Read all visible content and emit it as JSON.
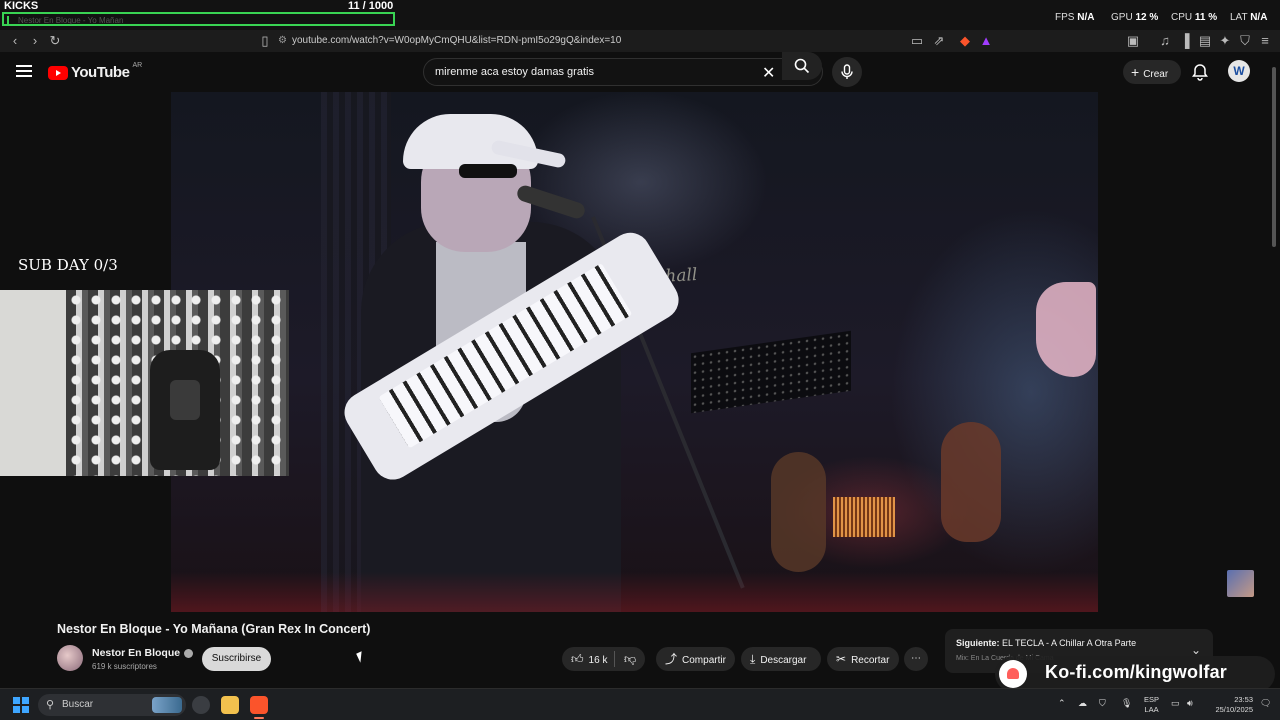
{
  "overlay": {
    "kicks_label": "KICKS",
    "kicks_count": "11  / 1000",
    "tab_ghost": "Nestor En Bloque - Yo Mañan"
  },
  "perf": {
    "fps_label": "FPS",
    "fps_value": "N/A",
    "gpu_label": "GPU",
    "gpu_value": "12 %",
    "cpu_label": "CPU",
    "cpu_value": "11 %",
    "lat_label": "LAT",
    "lat_value": "N/A"
  },
  "browser": {
    "url": "youtube.com/watch?v=W0opMyCmQHU&list=RDN-pmI5o29gQ&index=10"
  },
  "youtube": {
    "logo_text": "YouTube",
    "country": "AR",
    "search_value": "mirenme aca estoy damas gratis",
    "create_label": "Crear",
    "avatar_letter": "W"
  },
  "overlays": {
    "sub_day": "SUB DAY 0/3"
  },
  "video": {
    "title": "Nestor En Bloque - Yo Mañana (Gran Rex In Concert)",
    "channel": "Nestor En Bloque",
    "subscribers": "619 k suscriptores",
    "subscribe_label": "Suscribirse",
    "likes": "16 k",
    "share_label": "Compartir",
    "download_label": "Descargar",
    "clip_label": "Recortar"
  },
  "next": {
    "prefix": "Siguiente:",
    "title": "EL TECLA - A Chillar A Otra Parte",
    "mix": "Mix: En La Cuerda de Mi Cama"
  },
  "kofi": {
    "text": "Ko-fi.com/kingwolfar"
  },
  "taskbar": {
    "search_placeholder": "Buscar",
    "lang_line1": "ESP",
    "lang_line2": "LAA",
    "time": "23:53",
    "date": "25/10/2025"
  }
}
